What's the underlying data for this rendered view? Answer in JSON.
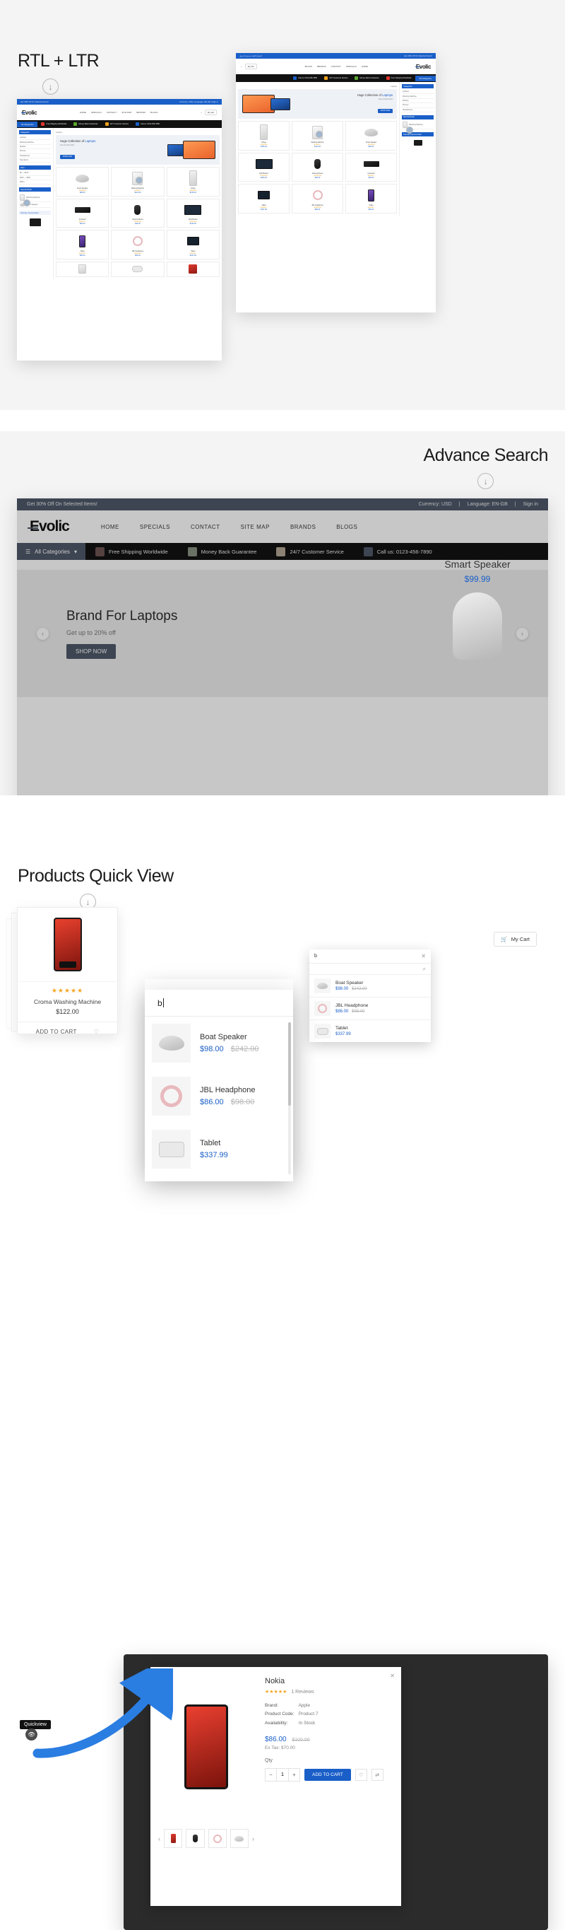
{
  "sections": {
    "rtl": {
      "heading": "RTL + LTR",
      "arrow_icon": "down-arrow-circle-icon"
    },
    "search": {
      "heading": "Advance Search",
      "arrow_icon": "down-arrow-circle-icon"
    },
    "quickview": {
      "heading": "Products Quick View",
      "arrow_icon": "down-arrow-circle-icon"
    }
  },
  "storefront": {
    "promo": "Get 30% Off On Selected Items!",
    "currency": "Currency: USD",
    "language": "Language: EN-GB",
    "signin": "Sign in",
    "logo": "Evolic",
    "nav": [
      "HOME",
      "SPECIALS",
      "CONTACT",
      "SITE MAP",
      "BRANDS",
      "BLOGS"
    ],
    "all_categories": "All Categories",
    "features": [
      {
        "label": "Free Shipping Worldwide",
        "color": "#e0352b",
        "icon": "shipping-icon"
      },
      {
        "label": "Money Back Guarantee",
        "color": "#5aa82e",
        "icon": "wallet-icon"
      },
      {
        "label": "24/7 Customer Service",
        "color": "#f0a01e",
        "icon": "support-icon"
      },
      {
        "label": "Call us: 0123-456-7890",
        "color": "#1a5fc8",
        "icon": "phone-icon"
      }
    ],
    "phone": "0123-456-7890",
    "cart_label": "My Cart",
    "hero": {
      "title": "Brand For Laptops",
      "subtitle": "Get up to 20% off",
      "button": "SHOP NOW"
    },
    "breadcrumb": "Laptops",
    "featured_product": {
      "name": "Smart Speaker",
      "price": "$99.99"
    },
    "sidebar_headings": [
      "Categories",
      "Filter",
      "Special Deals",
      "Security Camera Deal"
    ],
    "sidebar_items": [
      "Laptops",
      "Washing Machine",
      "Mobiles",
      "Phones",
      "Headphones",
      "Televisions",
      "Cameras"
    ],
    "products": [
      {
        "name": "Smart Speaker",
        "price": "$98.00",
        "rating": "★★★★★",
        "icon": "speaker-icon"
      },
      {
        "name": "Washing Machine",
        "price": "$122.00",
        "rating": "★★★★☆",
        "icon": "washer-icon"
      },
      {
        "name": "Fridge",
        "price": "$156.00",
        "rating": "★★★★★",
        "icon": "fridge-icon"
      },
      {
        "name": "Gaming Mouse",
        "price": "$48.00",
        "rating": "★★★★★",
        "icon": "mouse-icon"
      },
      {
        "name": "Keyboard",
        "price": "$65.00",
        "rating": "★★★★☆",
        "icon": "keyboard-icon"
      },
      {
        "name": "LED Monitor",
        "price": "$245.00",
        "rating": "★★★★★",
        "icon": "monitor-icon"
      },
      {
        "name": "Nokia",
        "price": "$86.00",
        "rating": "★★★★☆",
        "icon": "phone-product-icon"
      },
      {
        "name": "JBL Headphone",
        "price": "$86.00",
        "rating": "★★★★★",
        "icon": "headphone-icon"
      },
      {
        "name": "Tablet",
        "price": "$337.99",
        "rating": "★★★★☆",
        "icon": "tablet-icon"
      }
    ]
  },
  "search_overlay": {
    "query": "b",
    "close_icon": "close-icon",
    "search_icon": "search-icon",
    "results": [
      {
        "name": "Boat Speaker",
        "price": "$98.00",
        "old_price": "$242.00",
        "icon": "speaker-icon"
      },
      {
        "name": "JBL Headphone",
        "price": "$86.00",
        "old_price": "$98.00",
        "icon": "headphone-icon"
      },
      {
        "name": "Tablet",
        "price": "$337.99",
        "old_price": "",
        "icon": "controller-icon"
      }
    ]
  },
  "quickview_card": {
    "name": "Croma Washing Machine",
    "price": "$122.00",
    "rating": "★★★★★",
    "add_to_cart": "ADD TO CART",
    "wishlist_icon": "heart-icon",
    "badge": "Quickview",
    "eye_icon": "eye-icon"
  },
  "quickview_modal": {
    "title": "Nokia",
    "rating": "★★★★★",
    "reviews": "1 Reviews",
    "brand_label": "Brand:",
    "brand_value": "Apple",
    "code_label": "Product Code:",
    "code_value": "Product 7",
    "availability_label": "Availability:",
    "availability_value": "In Stock",
    "price": "$86.00",
    "old_price": "$100.00",
    "ex_tax": "Ex Tax: $70.00",
    "qty_label": "Qty",
    "qty_value": "1",
    "minus": "−",
    "plus": "+",
    "add_to_cart": "ADD TO CART",
    "wishlist_icon": "heart-icon",
    "compare_icon": "compare-icon",
    "close_icon": "close-icon",
    "prev_icon": "chevron-left-icon",
    "next_icon": "chevron-right-icon"
  }
}
